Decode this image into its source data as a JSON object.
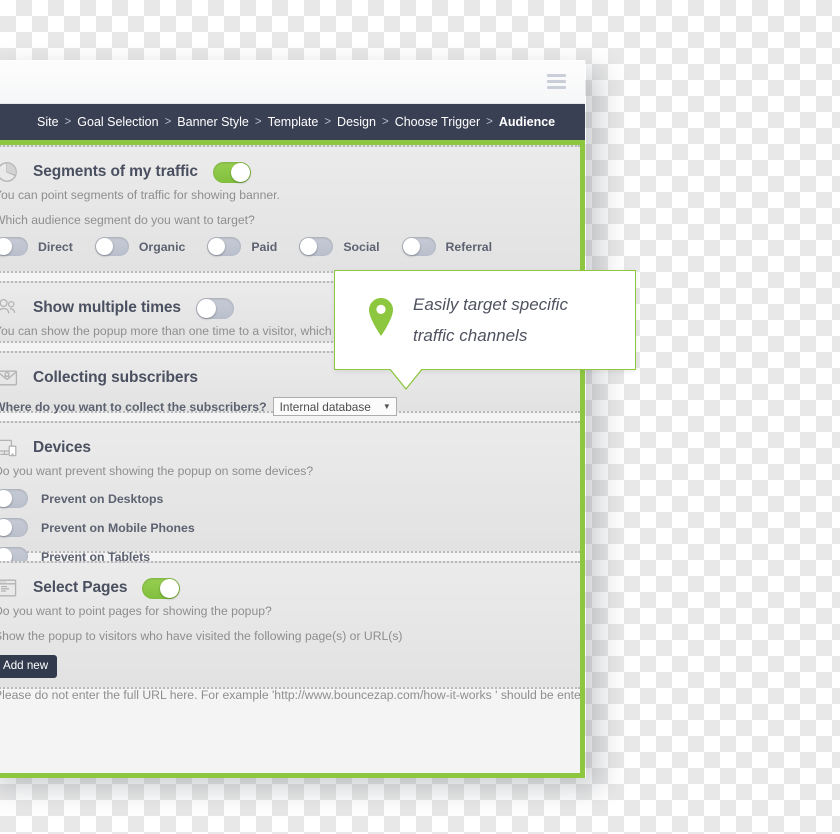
{
  "topbar": {
    "menu_icon": "hamburger-icon"
  },
  "breadcrumb": {
    "items": [
      {
        "label": "Site",
        "active": false
      },
      {
        "label": "Goal Selection",
        "active": false
      },
      {
        "label": "Banner Style",
        "active": false
      },
      {
        "label": "Template",
        "active": false
      },
      {
        "label": "Design",
        "active": false
      },
      {
        "label": "Choose Trigger",
        "active": false
      },
      {
        "label": "Audience",
        "active": true
      }
    ],
    "separator": ">"
  },
  "sections": {
    "segments": {
      "icon": "pie-chart-icon",
      "title": "Segments of my traffic",
      "toggle_on": true,
      "description": "You can point segments of traffic for showing banner.",
      "question": "Which audience segment do you want to target?",
      "options": [
        {
          "label": "Direct",
          "on": false
        },
        {
          "label": "Organic",
          "on": false
        },
        {
          "label": "Paid",
          "on": false
        },
        {
          "label": "Social",
          "on": false
        },
        {
          "label": "Referral",
          "on": false
        }
      ]
    },
    "multiple_times": {
      "icon": "users-icon",
      "title": "Show multiple times",
      "toggle_on": false,
      "description": "You can show the popup more than one time to a visitor, which did not see it earlier."
    },
    "collecting": {
      "icon": "envelope-user-icon",
      "title": "Collecting subscribers",
      "field_label": "Where do you want to collect the subscribers?",
      "select_value": "Internal database"
    },
    "devices": {
      "icon": "devices-icon",
      "title": "Devices",
      "description": "Do you want prevent showing the popup on some devices?",
      "options": [
        {
          "label": "Prevent on Desktops",
          "on": false
        },
        {
          "label": "Prevent on Mobile Phones",
          "on": false
        },
        {
          "label": "Prevent on Tablets",
          "on": false
        }
      ]
    },
    "select_pages": {
      "icon": "browser-page-icon",
      "title": "Select Pages",
      "toggle_on": true,
      "description": "Do you want to point pages for showing the popup?",
      "question": "Show the popup to visitors who have visited the following page(s) or URL(s)",
      "button_label": "Add new",
      "note": "Please do not enter the full URL here. For example 'http://www.bouncezap.com/how-it-works ' should be entered as"
    }
  },
  "callout": {
    "icon": "map-pin-icon",
    "line1": "Easily target specific",
    "line2": "traffic channels"
  },
  "colors": {
    "accent_green": "#8dc63f",
    "toggle_on": "#8dc63f",
    "dark_navy": "#3a4054",
    "button_navy": "#323a4e",
    "panel_bg": "#e5e5e5",
    "title_text": "#4a5060",
    "muted_text": "#8e8e8e"
  }
}
